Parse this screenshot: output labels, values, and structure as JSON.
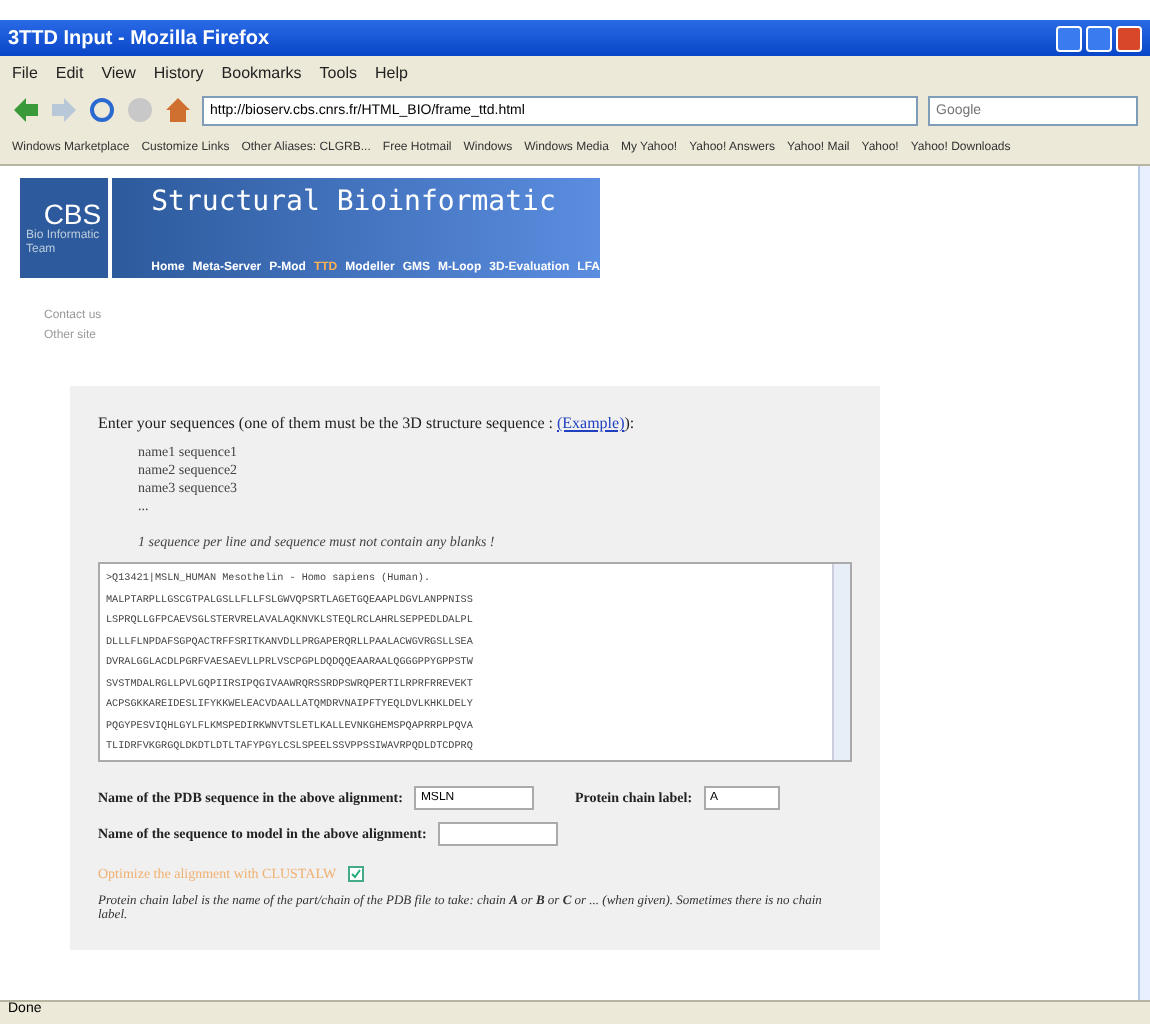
{
  "window": {
    "title": "3TTD Input - Mozilla Firefox"
  },
  "menu": [
    "File",
    "Edit",
    "View",
    "History",
    "Bookmarks",
    "Tools",
    "Help"
  ],
  "address": {
    "value": "http://bioserv.cbs.cnrs.fr/HTML_BIO/frame_ttd.html"
  },
  "search": {
    "placeholder": "Google"
  },
  "bookmarks": [
    "Windows Marketplace",
    "Customize Links",
    "Other Aliases: CLGRB...",
    "Free Hotmail",
    "Windows",
    "Windows Media",
    "My Yahoo!",
    "Yahoo! Answers",
    "Yahoo! Mail",
    "Yahoo!",
    "Yahoo! Downloads"
  ],
  "banner": {
    "logo": "CBS",
    "logo_sub": "Bio Informatic Team",
    "title": "Structural Bioinformatic",
    "nav": [
      {
        "label": "Home",
        "selected": false
      },
      {
        "label": "Meta-Server",
        "selected": false
      },
      {
        "label": "P-Mod",
        "selected": false
      },
      {
        "label": "TTD",
        "selected": true
      },
      {
        "label": "Modeller",
        "selected": false
      },
      {
        "label": "GMS",
        "selected": false
      },
      {
        "label": "M-Loop",
        "selected": false
      },
      {
        "label": "3D-Evaluation",
        "selected": false
      },
      {
        "label": "LFA",
        "selected": false
      }
    ]
  },
  "side_links": [
    "Contact us",
    "Other site"
  ],
  "form": {
    "intro": "Enter your sequences (one of them must be the 3D structure sequence : ",
    "example_link": "(Example)",
    "intro_end": "):",
    "format_lines": [
      "name1 sequence1",
      "name2 sequence2",
      "name3 sequence3",
      "..."
    ],
    "note": "1 sequence per line and sequence must not contain any blanks !",
    "sequence_lines": [
      ">Q13421|MSLN_HUMAN Mesothelin - Homo sapiens (Human).",
      "MALPTARPLLGSCGTPALGSLLFLLFSLGWVQPSRTLAGETGQEAAPLDGVLANPPNISS",
      "LSPRQLLGFPCAEVSGLSTERVRELAVALAQKNVKLSTEQLRCLAHRLSEPPEDLDALPL",
      "DLLLFLNPDAFSGPQACTRFFSRITKANVDLLPRGAPERQRLLPAALACWGVRGSLLSEA",
      "DVRALGGLACDLPGRFVAESAEVLLPRLVSCPGPLDQDQQEAARAALQGGGPPYGPPSTW",
      "SVSTMDALRGLLPVLGQPIIRSIPQGIVAAWRQRSSRDPSWRQPERTILRPRFRREVEKT",
      "ACPSGKKAREIDESLIFYKKWELEACVDAALLATQMDRVNAIPFTYEQLDVLKHKLDELY",
      "PQGYPESVIQHLGYLFLKMSPEDIRKWNVTSLETLKALLEVNKGHEMSPQAPRRPLPQVA",
      "TLIDRFVKGRGQLDKDTLDTLTAFYPGYLCSLSPEELSSVPPSSIWAVRPQDLDTCDPRQ"
    ],
    "pdb_label": "Name of the PDB sequence in the above alignment:",
    "pdb_value": "MSLN",
    "chain_label": "Protein chain label:",
    "chain_value": "A",
    "model_label": "Name of the sequence to model in the above alignment:",
    "optimize_label": "Optimize the alignment with CLUSTALW",
    "optimize_checked": true,
    "footnote": "Protein chain label is the name of the part/chain of the PDB file to take: chain **A** or **B** or **C** or ... (when given). Sometimes there is no chain label."
  },
  "status_bar": "Done"
}
